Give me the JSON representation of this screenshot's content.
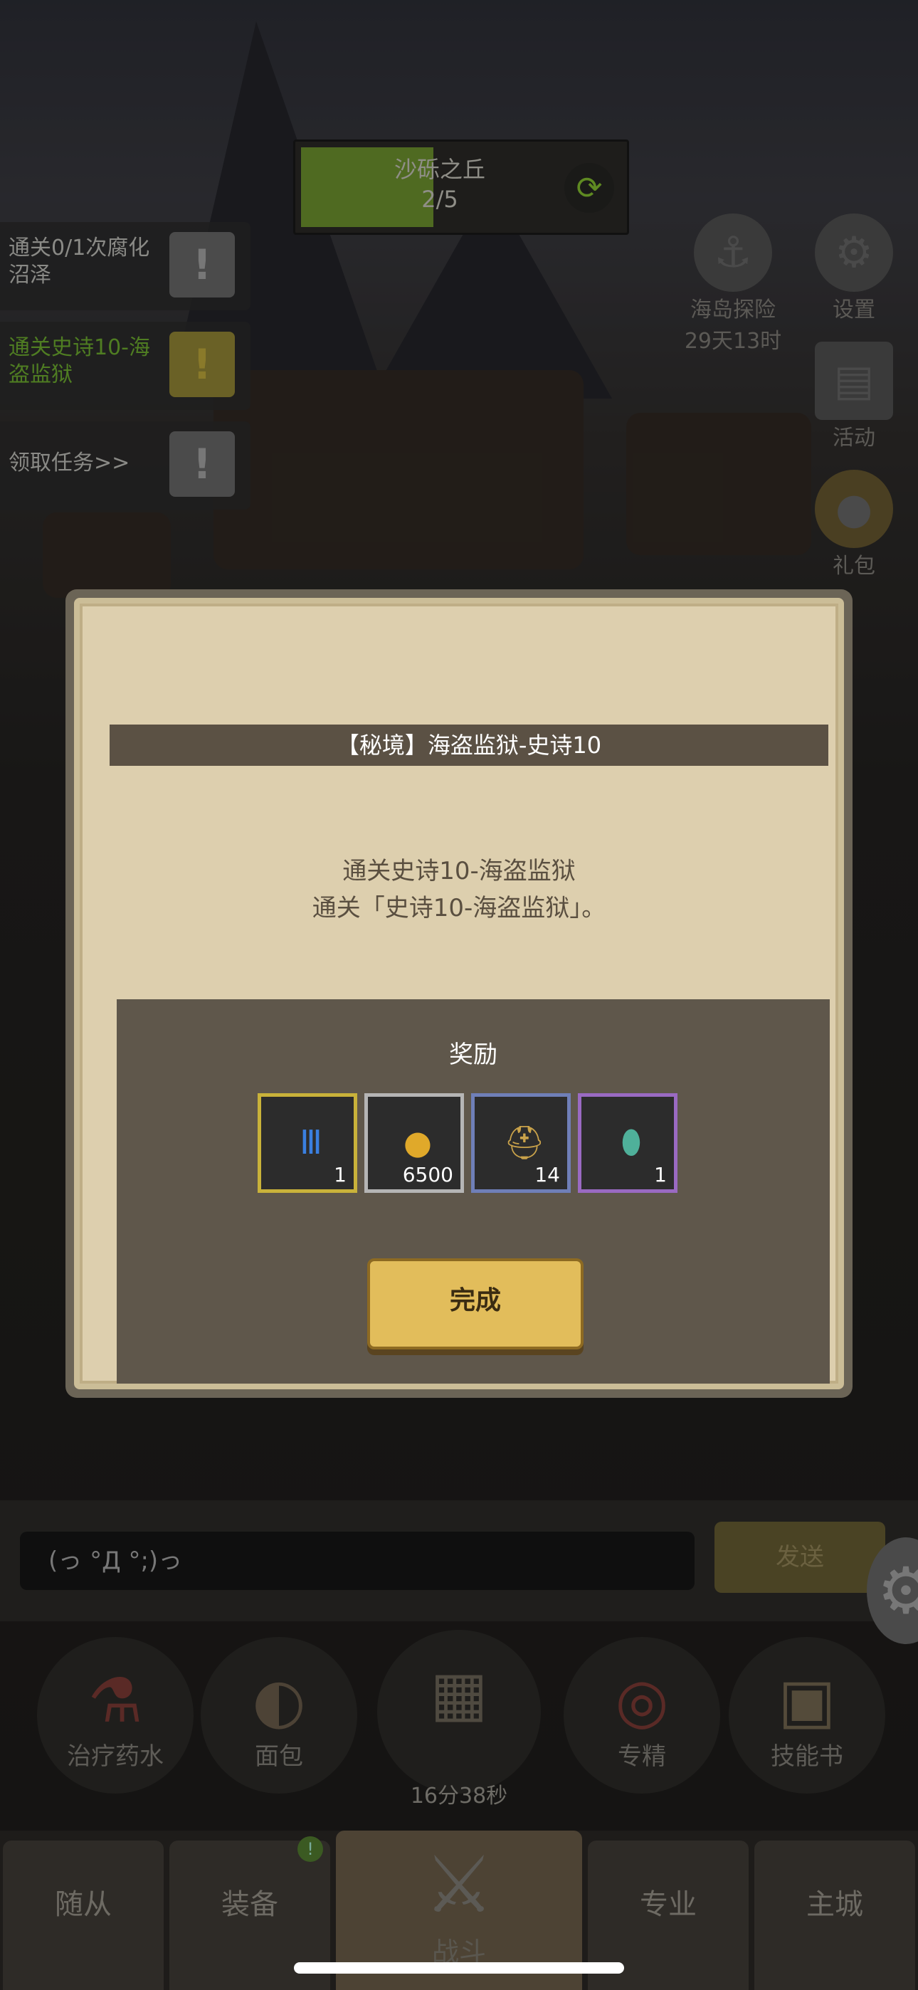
{
  "stage": {
    "name": "沙砾之丘",
    "progress_text": "2/5",
    "progress_fraction": 0.4
  },
  "quests": [
    {
      "text": "通关0/1次腐化沼泽",
      "badge": "!",
      "active": false
    },
    {
      "text": "通关史诗10-海盗监狱",
      "badge": "!",
      "active": true
    },
    {
      "text": "领取任务>>",
      "badge": "!",
      "active": false
    }
  ],
  "side": {
    "explore_label": "海岛探险",
    "explore_time": "29天13时",
    "settings_label": "设置",
    "events_label": "活动",
    "gift_label": "礼包"
  },
  "modal": {
    "title": "【秘境】海盗监狱-史诗10",
    "desc_line1": "通关史诗10-海盗监狱",
    "desc_line2": "通关「史诗10-海盗监狱」。",
    "reward_title": "奖励",
    "rewards": [
      {
        "icon": "blue-medal-icon",
        "count": "1",
        "border": "#c9b23a"
      },
      {
        "icon": "gold-coin-icon",
        "count": "6500",
        "border": "#b5b5b5"
      },
      {
        "icon": "helmet-icon",
        "count": "14",
        "border": "#6f7fb8"
      },
      {
        "icon": "egg-icon",
        "count": "1",
        "border": "#9a6ac2"
      }
    ],
    "done_label": "完成"
  },
  "chat": {
    "input_text": "(っ °Д °;)っ",
    "send_label": "发送"
  },
  "quick_actions": [
    {
      "label": "治疗药水",
      "icon": "potion-icon"
    },
    {
      "label": "面包",
      "icon": "bread-icon"
    },
    {
      "label": "专精",
      "icon": "mastery-icon"
    },
    {
      "label": "技能书",
      "icon": "skillbook-icon"
    }
  ],
  "chest_timer": "16分38秒",
  "tabs": {
    "followers": "随从",
    "equipment": "装备",
    "battle": "战斗",
    "profession": "专业",
    "city": "主城",
    "equipment_badge": "!"
  }
}
